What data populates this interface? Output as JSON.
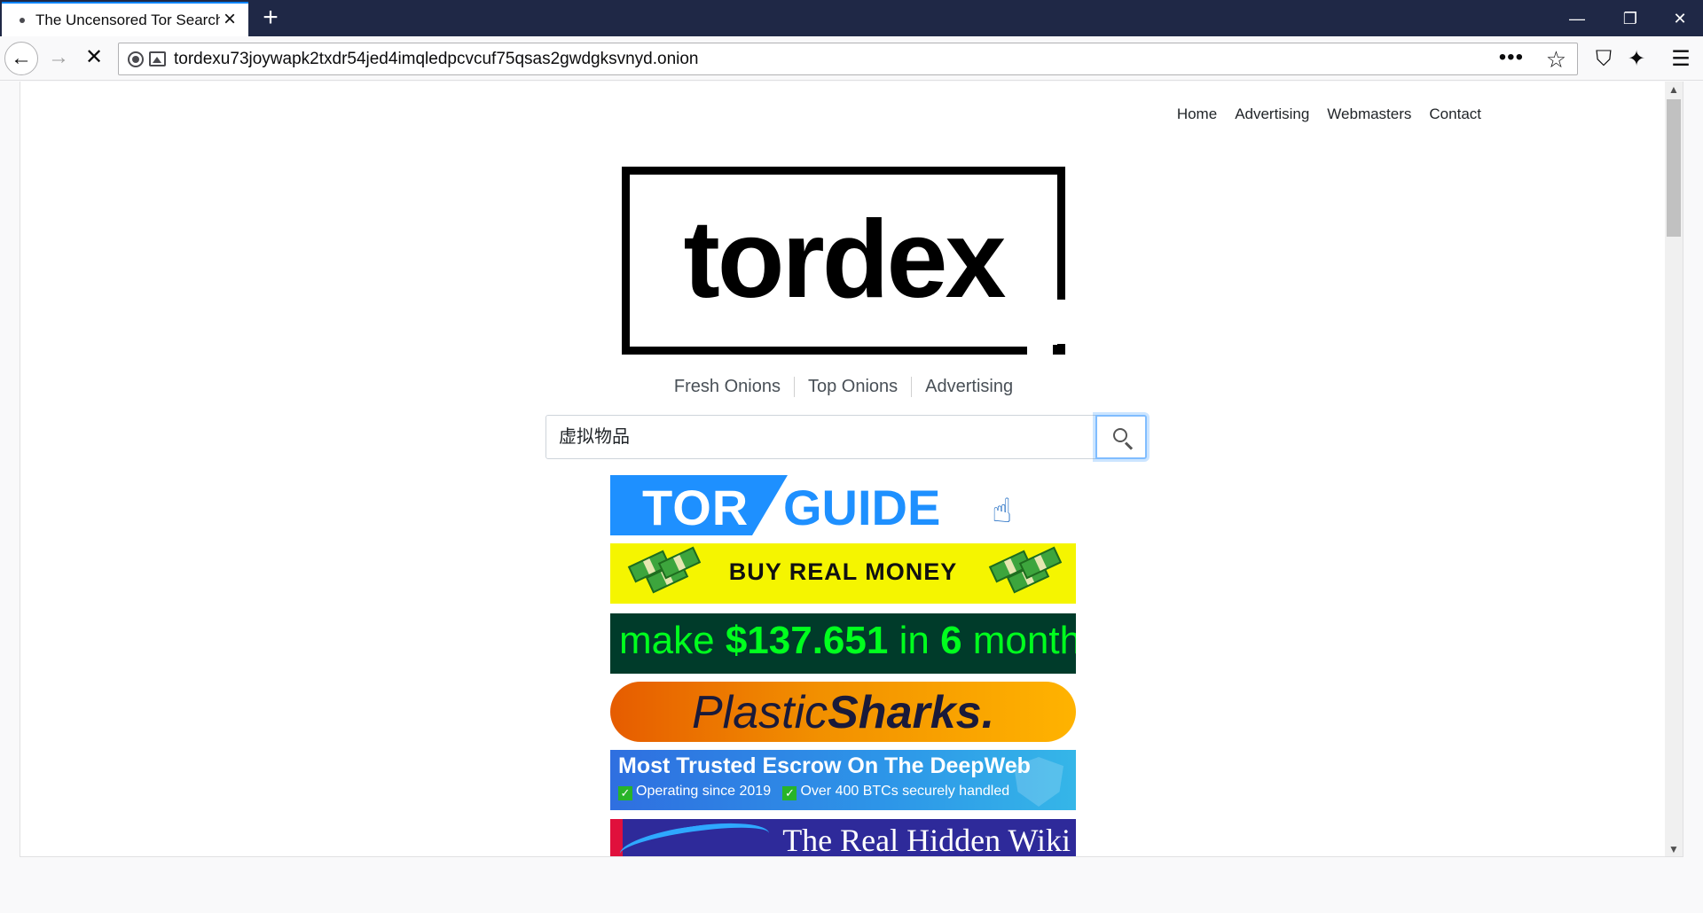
{
  "browser": {
    "tab_title": "The Uncensored Tor Search E",
    "tab_close": "×",
    "new_tab": "+",
    "url": "tordexu73joywapk2txdr54jed4imqledpcvcuf75qsas2gwdgksvnyd.onion",
    "page_actions": "•••",
    "bookmark": "☆",
    "win_minimize": "—",
    "win_restore": "❐",
    "win_close": "✕",
    "back": "←",
    "forward": "→",
    "stop": "✕",
    "shield": "⛉",
    "extensions": "✦",
    "menu": "☰"
  },
  "site": {
    "topnav": [
      "Home",
      "Advertising",
      "Webmasters",
      "Contact"
    ],
    "logo_text": "tordex",
    "subnav": [
      "Fresh Onions",
      "Top Onions",
      "Advertising"
    ],
    "search_value": "虚拟物品"
  },
  "ads": {
    "tor_guide": {
      "part1": "TOR",
      "part2": "GUIDE"
    },
    "buy_money": "BUY REAL MONEY",
    "make_money": {
      "pre": "make ",
      "amount": "$137.651",
      "mid": " in ",
      "num": "6",
      "post": " month"
    },
    "plastic_sharks": {
      "part1": "Plastic",
      "part2": "Sharks",
      "dot": "."
    },
    "escrow": {
      "title": "Most Trusted Escrow On The DeepWeb",
      "point1": "Operating since 2019",
      "point2": "Over 400 BTCs securely handled"
    },
    "hidden_wiki": "The Real Hidden Wiki"
  },
  "colors": {
    "tabbar": "#1f2846",
    "accent": "#0a84ff",
    "money_green": "#00ff1e",
    "escrow_blue": "#2d96e8"
  }
}
